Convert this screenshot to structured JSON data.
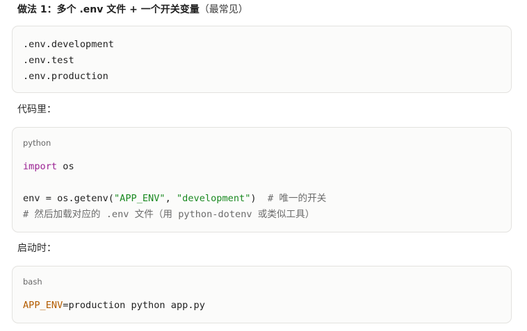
{
  "heading": {
    "bold": "做法 1：多个 .env 文件 + 一个开关变量",
    "light": "（最常见）"
  },
  "env_files": {
    "lines": [
      ".env.development",
      ".env.test",
      ".env.production"
    ]
  },
  "code_label": "代码里：",
  "python_block": {
    "language": "python",
    "line1_keyword": "import",
    "line1_rest": " os",
    "line2_prefix": "env = os.getenv(",
    "line2_arg1": "\"APP_ENV\"",
    "line2_sep": ", ",
    "line2_arg2": "\"development\"",
    "line2_suffix": ")  ",
    "line2_comment": "# 唯一的开关",
    "line3_comment": "# 然后加载对应的 .env 文件（用 python-dotenv 或类似工具）"
  },
  "startup_label": "启动时：",
  "bash_block": {
    "language": "bash",
    "var": "APP_ENV",
    "rest": "=production python app.py"
  },
  "colors": {
    "keyword": "#9b2393",
    "string": "#1b8a22",
    "comment": "#6b6b6b",
    "bash_var": "#b35c00",
    "card_bg": "#fbfbfa",
    "card_border": "#e3e2df"
  }
}
